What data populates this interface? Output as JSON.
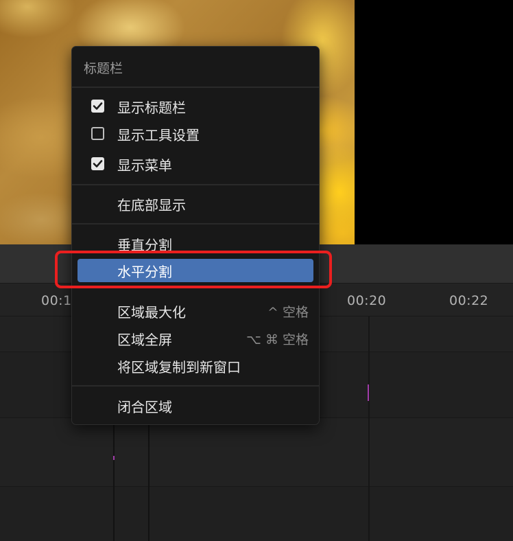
{
  "timeline": {
    "ruler_labels": [
      "00:1",
      "00:20",
      "00:22"
    ]
  },
  "menu": {
    "title": "标题栏",
    "items": [
      {
        "label": "显示标题栏",
        "checked": true
      },
      {
        "label": "显示工具设置",
        "checked": false
      },
      {
        "label": "显示菜单",
        "checked": true
      },
      {
        "label": "在底部显示"
      },
      {
        "label": "垂直分割"
      },
      {
        "label": "水平分割",
        "highlighted": true
      },
      {
        "label": "区域最大化",
        "shortcut": "^ 空格"
      },
      {
        "label": "区域全屏",
        "shortcut": "⌥ ⌘ 空格"
      },
      {
        "label": "将区域复制到新窗口"
      },
      {
        "label": "闭合区域"
      }
    ]
  },
  "colors": {
    "highlight": "#4772b3",
    "annotation": "#ea1f1f",
    "keyframe_marker": "#a03ca8"
  }
}
